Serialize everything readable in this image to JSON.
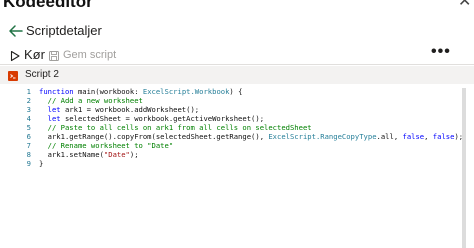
{
  "window": {
    "title": "Kodeeditor"
  },
  "header": {
    "breadcrumb": "Scriptdetaljer"
  },
  "toolbar": {
    "run_label": "Kør",
    "save_label": "Gem script",
    "more_label": "•••"
  },
  "script": {
    "name": "Script 2"
  },
  "editor": {
    "line_numbers": [
      "1",
      "2",
      "3",
      "4",
      "5",
      "6",
      "7",
      "8",
      "9"
    ],
    "lines": [
      [
        {
          "t": "kw",
          "v": "function "
        },
        {
          "t": "",
          "v": "main(workbook: "
        },
        {
          "t": "ty",
          "v": "ExcelScript.Workbook"
        },
        {
          "t": "",
          "v": ") {"
        }
      ],
      [
        {
          "t": "cm",
          "v": "  // Add a new worksheet"
        }
      ],
      [
        {
          "t": "kw",
          "v": "  let "
        },
        {
          "t": "",
          "v": "ark1 = workbook.addWorksheet();"
        }
      ],
      [
        {
          "t": "kw",
          "v": "  let "
        },
        {
          "t": "",
          "v": "selectedSheet = workbook.getActiveWorksheet();"
        }
      ],
      [
        {
          "t": "cm",
          "v": "  // Paste to all cells on ark1 from all cells on selectedSheet"
        }
      ],
      [
        {
          "t": "",
          "v": "  ark1.getRange().copyFrom(selectedSheet.getRange(), "
        },
        {
          "t": "ty",
          "v": "ExcelScript.RangeCopyType"
        },
        {
          "t": "",
          "v": ".all, "
        },
        {
          "t": "kw",
          "v": "false"
        },
        {
          "t": "",
          "v": ", "
        },
        {
          "t": "kw",
          "v": "false"
        },
        {
          "t": "",
          "v": ");"
        }
      ],
      [
        {
          "t": "cm",
          "v": "  // Rename worksheet to \"Date\""
        }
      ],
      [
        {
          "t": "",
          "v": "  ark1.setName("
        },
        {
          "t": "str",
          "v": "\"Date\""
        },
        {
          "t": "",
          "v": ");"
        }
      ],
      [
        {
          "t": "",
          "v": "}"
        }
      ]
    ]
  },
  "colors": {
    "accent": "#217346",
    "keyword": "#0000ff",
    "comment": "#008000",
    "string": "#a31515",
    "type": "#267f99",
    "line_number": "#237893"
  },
  "icons": [
    "back-arrow-icon",
    "play-icon",
    "save-icon",
    "script-icon",
    "minimize-icon",
    "close-icon"
  ]
}
